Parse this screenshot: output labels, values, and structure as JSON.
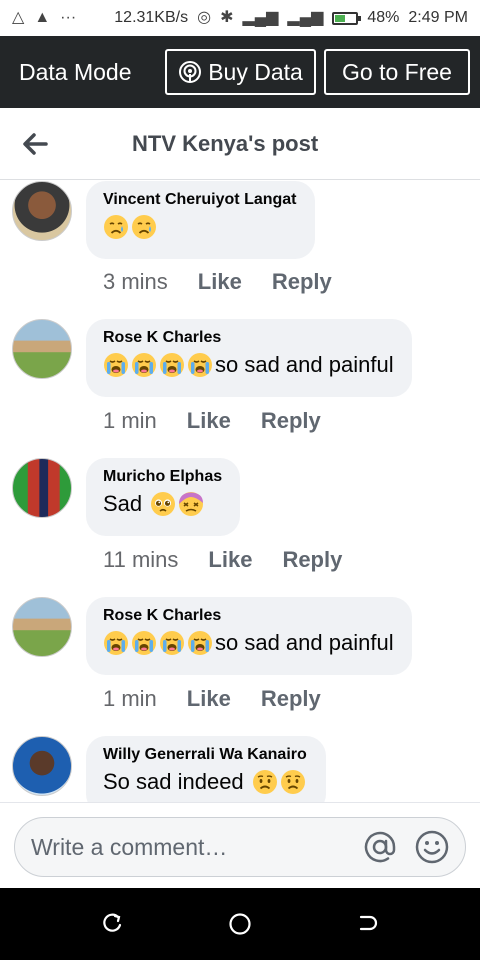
{
  "status_bar": {
    "speed": "12.31KB/s",
    "battery": "48%",
    "battery_level": 0.48,
    "time": "2:49 PM"
  },
  "data_mode": {
    "label": "Data Mode",
    "buy_label": "Buy Data",
    "free_label": "Go to Free"
  },
  "header": {
    "title": "NTV Kenya's post"
  },
  "comments": [
    {
      "name": "Vincent Cheruiyot Langat",
      "text": "",
      "emojis": [
        "sad-tear",
        "sad-tear"
      ],
      "time": "3 mins",
      "like": "Like",
      "reply": "Reply"
    },
    {
      "name": "Rose K Charles",
      "text": "so sad and painful",
      "emojis": [
        "crying",
        "crying",
        "crying",
        "crying"
      ],
      "time": "1 min",
      "like": "Like",
      "reply": "Reply"
    },
    {
      "name": "Muricho Elphas",
      "text": "Sad",
      "emojis": [
        "pleading",
        "dizzy"
      ],
      "time": "11 mins",
      "like": "Like",
      "reply": "Reply"
    },
    {
      "name": "Rose K Charles",
      "text": "so sad and painful",
      "emojis": [
        "crying",
        "crying",
        "crying",
        "crying"
      ],
      "time": "1 min",
      "like": "Like",
      "reply": "Reply"
    },
    {
      "name": "Willy Generrali Wa Kanairo",
      "text": "So sad indeed",
      "emojis": [
        "worried",
        "worried"
      ],
      "time": "",
      "like": "",
      "reply": ""
    }
  ],
  "composer": {
    "placeholder": "Write a comment…"
  },
  "colors": {
    "data_bar_bg": "#232628",
    "bubble_bg": "#f0f2f5",
    "meta_text": "#65676b"
  }
}
